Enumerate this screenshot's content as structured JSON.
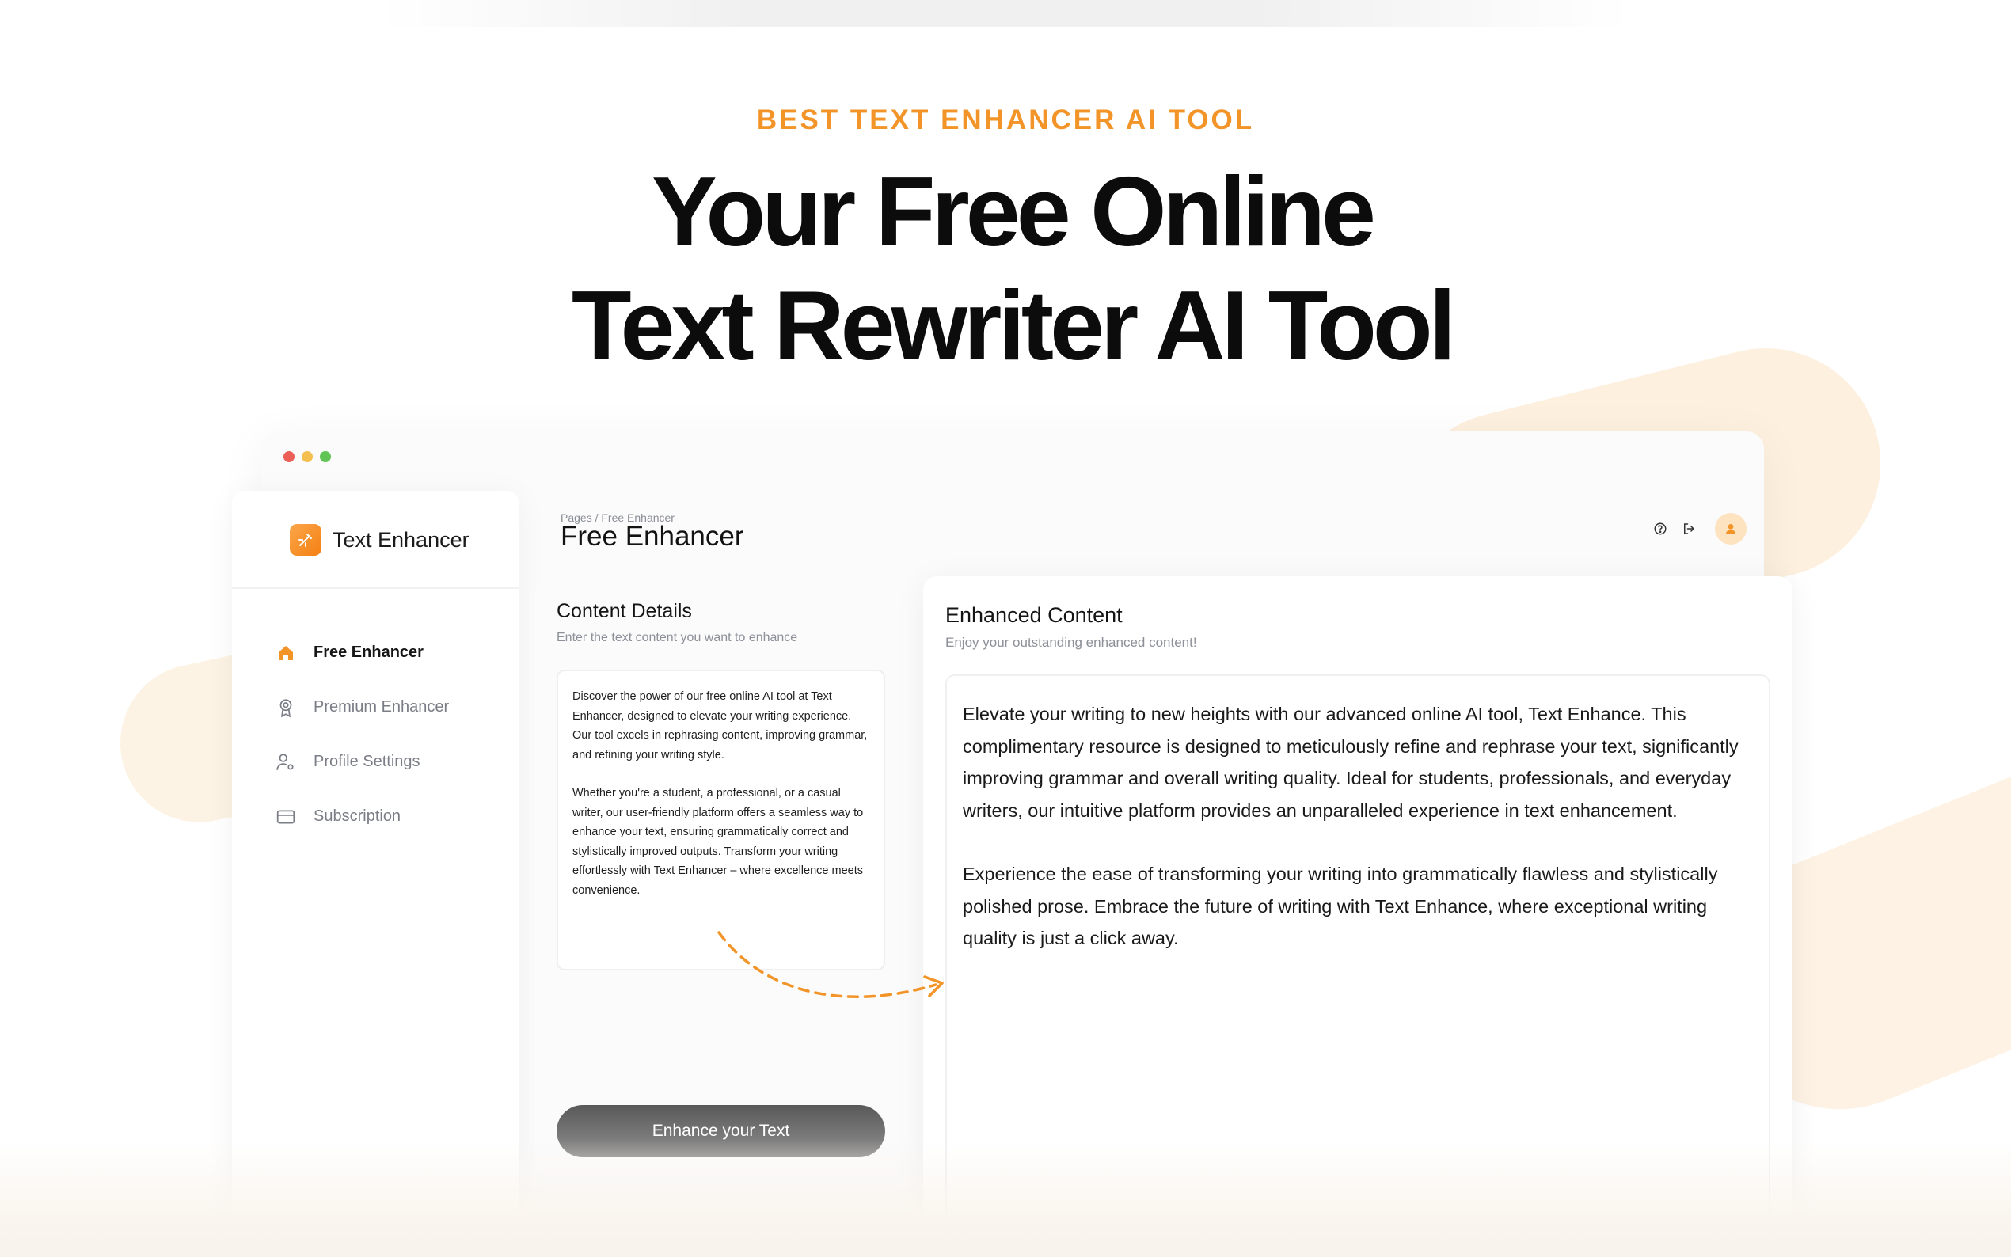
{
  "hero": {
    "eyebrow": "BEST TEXT ENHANCER AI TOOL",
    "headline_line1": "Your Free Online",
    "headline_line2": "Text Rewriter AI Tool"
  },
  "window": {
    "dot_colors": [
      "#ec5f57",
      "#f4bf4f",
      "#60c554"
    ]
  },
  "sidebar": {
    "brand": "Text Enhancer",
    "items": [
      {
        "label": "Free Enhancer",
        "icon": "home-icon",
        "active": true
      },
      {
        "label": "Premium Enhancer",
        "icon": "award-icon",
        "active": false
      },
      {
        "label": "Profile Settings",
        "icon": "user-settings-icon",
        "active": false
      },
      {
        "label": "Subscription",
        "icon": "credit-card-icon",
        "active": false
      }
    ]
  },
  "header": {
    "breadcrumb": "Pages / Free Enhancer",
    "title": "Free Enhancer"
  },
  "content_details": {
    "title": "Content Details",
    "subtitle": "Enter the text content you want to enhance",
    "paragraph1": "Discover the power of our free online AI tool at Text Enhancer, designed to elevate your writing experience. Our tool excels in rephrasing content, improving grammar, and refining your writing style.",
    "paragraph2": "Whether you're a student, a professional, or a casual writer, our user-friendly platform offers a seamless way to enhance your text, ensuring grammatically correct and stylistically improved outputs. Transform your writing effortlessly with Text Enhancer – where excellence meets convenience.",
    "button_label": "Enhance your Text"
  },
  "enhanced_content": {
    "title": "Enhanced Content",
    "subtitle": "Enjoy your outstanding enhanced content!",
    "paragraph1": "Elevate your writing to new heights with our advanced online AI tool, Text Enhance. This complimentary resource is designed to meticulously refine and rephrase your text, significantly improving grammar and overall writing quality. Ideal for students, professionals, and everyday writers, our intuitive platform provides an unparalleled experience in text enhancement.",
    "paragraph2": "Experience the ease of transforming your writing into grammatically flawless and stylistically polished prose. Embrace the future of writing with Text Enhance, where exceptional writing quality is just a click away."
  },
  "colors": {
    "accent": "#f29427",
    "accent_light": "#fde3bf"
  }
}
